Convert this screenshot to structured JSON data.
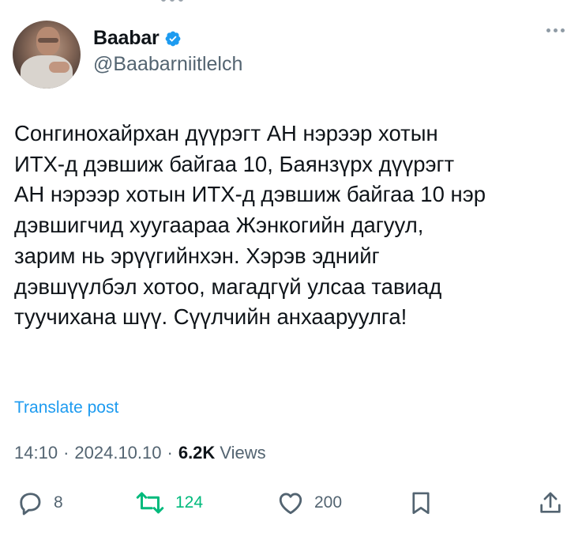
{
  "colors": {
    "accent": "#1d9bf0",
    "retweeted": "#00ba7c",
    "secondary_text": "#536471",
    "primary_text": "#0f1419"
  },
  "author": {
    "display_name": "Baabar",
    "handle": "@Baabarniitlelch",
    "verified_icon": "verified-badge-icon"
  },
  "tweet": {
    "text": "Сонгинохайрхан дүүрэгт АН нэрээр хотын\nИТХ-д дэвшиж байгаа 10, Баянзүрх дүүрэгт\nАН нэрээр хотын ИТХ-д дэвшиж байгаа 10 нэр\nдэвшигчид хуугаараа Жэнкогийн дагуул,\nзарим нь эрүүгийнхэн. Хэрэв эднийг\nдэвшүүлбэл хотоо, магадгүй улсаа тавиад\nтуучихана шүү. Сүүлчийн анхааруулга!",
    "translate_label": "Translate post"
  },
  "meta": {
    "time": "14:10",
    "separator": "·",
    "date": "2024.10.10",
    "views_count": "6.2K",
    "views_label": "Views"
  },
  "actions": {
    "replies": "8",
    "retweets": "124",
    "likes": "200",
    "reply_icon": "reply-icon",
    "retweet_icon": "retweet-icon",
    "like_icon": "heart-icon",
    "bookmark_icon": "bookmark-icon",
    "share_icon": "share-icon"
  }
}
